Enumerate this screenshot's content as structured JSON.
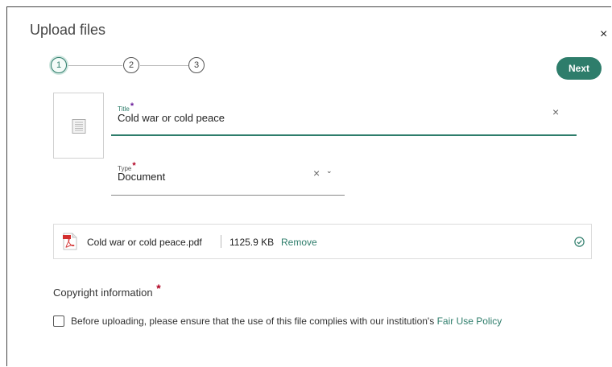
{
  "dialog": {
    "title": "Upload files",
    "close_label": "×"
  },
  "stepper": {
    "steps": [
      "1",
      "2",
      "3"
    ],
    "active_step": 1
  },
  "next_label": "Next",
  "form": {
    "title_field": {
      "label": "Title",
      "required_mark": "*",
      "value": "Cold war or cold peace",
      "clear_label": "×"
    },
    "type_field": {
      "label": "Type",
      "required_mark": "*",
      "value": "Document",
      "clear_label": "×",
      "chevron_label": "⌄"
    }
  },
  "file": {
    "name": "Cold war or cold peace.pdf",
    "size": "1125.9 KB",
    "remove_label": "Remove",
    "status": "uploaded"
  },
  "copyright": {
    "heading": "Copyright information",
    "required_mark": "*",
    "consent_text": "Before uploading, please ensure that the use of this file complies with our institution's ",
    "policy_link": "Fair Use Policy",
    "checked": false
  },
  "colors": {
    "accent": "#2e7d6b",
    "required": "#b00020"
  },
  "icons": {
    "document_thumb": "document-icon",
    "file_type": "pdf-icon",
    "status": "check-circle-icon"
  }
}
